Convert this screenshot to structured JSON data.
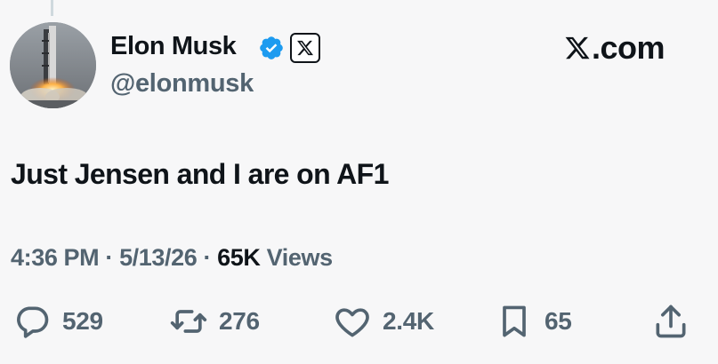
{
  "author": {
    "name": "Elon Musk",
    "handle": "@elonmusk",
    "verified_icon": "verified-badge-icon",
    "affiliation_icon": "x-logo-icon",
    "accent": "#1d9bf0"
  },
  "brand": {
    "label": ".com",
    "logo_icon": "x-logo-icon"
  },
  "tweet": {
    "text": "Just Jensen and I are on AF1"
  },
  "meta": {
    "time": "4:36 PM",
    "separator": "·",
    "date": "5/13/26",
    "views_count": "65K",
    "views_label": "Views"
  },
  "actions": {
    "replies": "529",
    "reposts": "276",
    "likes": "2.4K",
    "bookmarks": "65"
  },
  "colors": {
    "text": "#0f1419",
    "muted": "#536471",
    "background": "#f7f7f8"
  }
}
